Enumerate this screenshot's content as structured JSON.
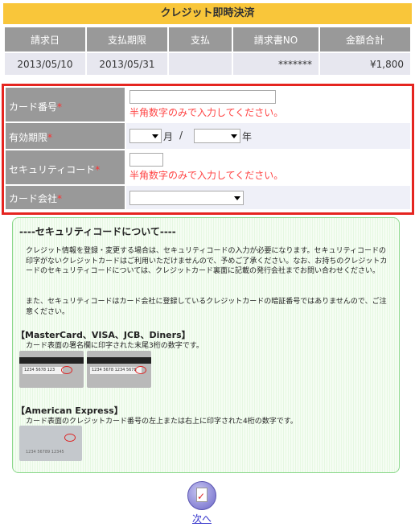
{
  "title": "クレジット即時決済",
  "summary": {
    "headers": [
      "請求日",
      "支払期限",
      "支払",
      "請求書NO",
      "金額合計"
    ],
    "row": [
      "2013/05/10",
      "2013/05/31",
      "",
      "*******",
      "¥1,800"
    ]
  },
  "form": {
    "card_number": {
      "label": "カード番号",
      "required_mark": "*",
      "value": "",
      "error": "半角数字のみで入力してください。"
    },
    "expiry": {
      "label": "有効期限",
      "required_mark": "*",
      "month_value": "",
      "month_unit": "月",
      "separator": "/",
      "year_value": "",
      "year_unit": "年"
    },
    "security_code": {
      "label": "セキュリティコード",
      "required_mark": "*",
      "value": "",
      "error": "半角数字のみで入力してください。"
    },
    "card_company": {
      "label": "カード会社",
      "required_mark": "*",
      "value": ""
    }
  },
  "info": {
    "title": "----セキュリティコードについて----",
    "para1": "クレジット情報を登録・変更する場合は、セキュリティコードの入力が必要になります。セキュリティコードの印字がないクレジットカードはご利用いただけませんので、予めご了承ください。なお、お持ちのクレジットカードのセキュリティコードについては、クレジットカード裏面に記載の発行会社までお問い合わせください。",
    "para2": "また、セキュリティコードはカード会社に登録しているクレジットカードの暗証番号ではありませんので、ご注意ください。",
    "brand1_title": "【MasterCard、VISA、JCB、Diners】",
    "brand1_desc": "カード表面の署名欄に印字された末尾3桁の数字です。",
    "card_sample_1": "1234 5678 123",
    "card_sample_2": "1234 5678 1234 5678 123",
    "brand2_title": "【American Express】",
    "brand2_desc": "カード表面のクレジットカード番号の左上または右上に印字された4桁の数字です。",
    "card_sample_amex": "1234 56789 12345"
  },
  "next": {
    "label": "次へ"
  },
  "colors": {
    "title_bg": "#f9c63a",
    "header_bg": "#999999",
    "error": "#ff4444",
    "border_red": "#e52520",
    "info_border": "#8cd88c",
    "link": "#3333cc"
  }
}
